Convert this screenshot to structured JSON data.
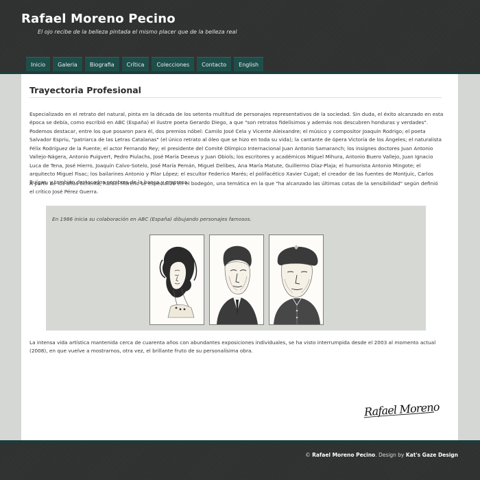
{
  "site": {
    "title": "Rafael Moreno Pecino",
    "tagline": "El ojo recibe de la belleza pintada el mismo placer que de la belleza real"
  },
  "nav": {
    "items": [
      {
        "label": "Inicio"
      },
      {
        "label": "Galeria"
      },
      {
        "label": "Biografia"
      },
      {
        "label": "Crítica"
      },
      {
        "label": "Colecciones"
      },
      {
        "label": "Contacto"
      },
      {
        "label": "English"
      }
    ]
  },
  "page": {
    "title": "Trayectoria Profesional",
    "paragraphs": [
      "Especializado en el retrato del natural, pinta en la década de los setenta multitud de personajes representativos de la sociedad. Sin duda, el éxito alcanzado en esta época se debía, como escribió en ABC (España) el ilustre poeta Gerardo Diego, a que \"son retratos fidelísimos y además nos descubren honduras y verdades\".",
      "Podemos destacar, entre los que posaron para él, dos premios nóbel: Camilo José Cela y Vicente Aleixandre; el músico y compositor Joaquín Rodrigo; el poeta Salvador Espriu, \"patriarca de las Letras Catalanas\" (el único retrato al óleo que se hizo en toda su vida); la cantante de ópera Victoria de los Ángeles; el naturalista Félix Rodríguez de la Fuente; el actor Fernando Rey; el presidente del Comité Olímpico Internacional Juan Antonio Samaranch; los insignes doctores Juan Antonio Vallejo-Nágera, Antonio Puigvert, Pedro Piulachs, José María Dexeus y Juan Obiols; los escritores y académicos Miguel Mihura, Antonio Buero Vallejo, Juan Ignacio Luca de Tena, José Hierro, Joaquín Calvo-Sotelo, José María Pemán, Miguel Delibes, Ana María Matute, Guillermo Díaz-Plaja; el humorista Antonio Mingote; el arquitecto Miguel Fisac; los bailarines Antonio y Pilar López; el escultor Federico Marés; el polifacético Xavier Cugat; el creador de las fuentes de Montjuic, Carlos Buïgas; y también destacados nombres de la banca y empresa.",
      "A partir de los años ochenta, Rafael Moreno se especializó en el bodegón, una temática en la que \"ha alcanzado las últimas cotas de la sensibilidad\" según definió el crítico José Pérez Guerra.",
      "La intensa vida artística mantenida cerca de cuarenta años con abundantes exposiciones individuales, se ha visto interrumpida desde el 2003 al momento actual (2008), en que vuelve a mostrarnos, otra vez, el brillante fruto de su personalísima obra."
    ],
    "figure": {
      "caption": "En 1986 inicia su colaboración en ABC (España) dibujando personajes famosos."
    },
    "signature": "Rafael Moreno"
  },
  "footer": {
    "copyright_prefix": "© ",
    "copyright_name": "Rafael Moreno Pecino",
    "design_prefix": ". Design by ",
    "designer": "Kat's Gaze Design"
  },
  "colors": {
    "header_bg": "#313232",
    "nav_tab": "#1e4e4a",
    "accent_line": "#1b3d3a",
    "page_bg": "#d4d7d3",
    "content_bg": "#ffffff"
  }
}
